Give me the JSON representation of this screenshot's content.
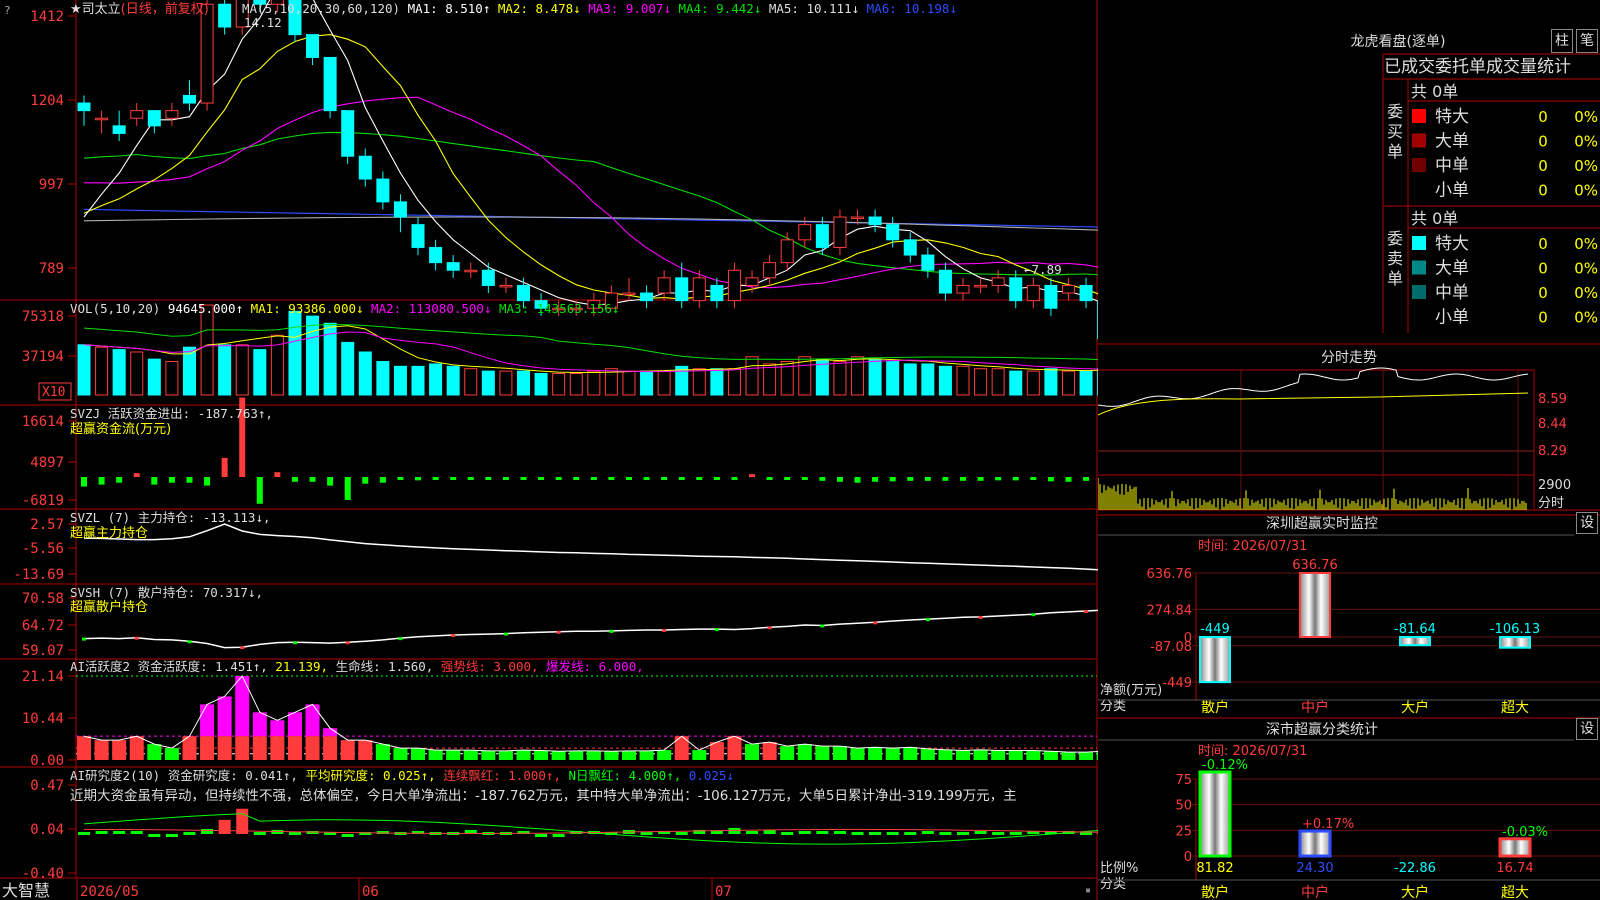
{
  "colors": {
    "up": "#ff3c3c",
    "down": "#00ffff",
    "ma1": "#ffffff",
    "ma2": "#ffff00",
    "ma3": "#ff00ff",
    "ma4": "#00e000",
    "ma5": "#b0b0b0",
    "ma6": "#2d4dff",
    "grid": "#b00000",
    "green": "#00ff00",
    "magenta": "#ff00ff",
    "yellow": "#ffff00"
  },
  "stock": {
    "title": "★司太立",
    "mode": "(日线，前复权)",
    "high_label": "14.12",
    "low_label": "←7.89"
  },
  "ma_legend": [
    {
      "label": "MA(5,10,20,30,60,120)",
      "color": "#dddddd"
    },
    {
      "label": "MA1: 8.510↑",
      "color": "#ffffff"
    },
    {
      "label": "MA2: 8.478↓",
      "color": "#ffff00"
    },
    {
      "label": "MA3: 9.007↓",
      "color": "#ff00ff"
    },
    {
      "label": "MA4: 9.442↓",
      "color": "#00e000"
    },
    {
      "label": "MA5: 10.111↓",
      "color": "#dddddd"
    },
    {
      "label": "MA6: 10.198↓",
      "color": "#2d4dff"
    }
  ],
  "price_ticks": [
    "1412",
    "1204",
    "997",
    "789"
  ],
  "vol_legend": [
    {
      "label": "VOL(5,10,20)",
      "color": "#dddddd"
    },
    {
      "label": "94645.000↑",
      "color": "#ffffff"
    },
    {
      "label": "MA1: 93386.000↓",
      "color": "#ffff00"
    },
    {
      "label": "MA2: 113080.500↓",
      "color": "#ff00ff"
    },
    {
      "label": "MA3: 143563.156↓",
      "color": "#00e000"
    }
  ],
  "vol_ticks": [
    "75318",
    "37194"
  ],
  "vol_unit": "X10",
  "svzj": {
    "legend": "SVZJ  活跃资金进出: -187.763↑,",
    "sub": "超赢资金流(万元)",
    "ticks": [
      "16614",
      "4897",
      "-6819"
    ]
  },
  "svzl": {
    "legend": "SVZL (7) 主力持仓: -13.113↓,",
    "sub": "超赢主力持仓",
    "ticks": [
      "2.57",
      "-5.56",
      "-13.69"
    ]
  },
  "svsh": {
    "legend": "SVSH (7) 散户持仓: 70.317↓,",
    "sub": "超赢散户持仓",
    "ticks": [
      "70.58",
      "64.72",
      "59.07"
    ]
  },
  "ai1": {
    "legend": [
      {
        "label": "AI活跃度2 资金活跃度: 1.451↑,",
        "color": "#dddddd"
      },
      {
        "label": "21.139,",
        "color": "#ffff00"
      },
      {
        "label": "生命线: 1.560,",
        "color": "#dddddd"
      },
      {
        "label": "强势线: 3.000,",
        "color": "#ff3c3c"
      },
      {
        "label": "爆发线: 6.000,",
        "color": "#ff00ff"
      }
    ],
    "ticks": [
      "21.14",
      "10.44",
      "0.00"
    ]
  },
  "ai2": {
    "legend": [
      {
        "label": "AI研究度2(10) 资金研究度: 0.041↑,",
        "color": "#dddddd"
      },
      {
        "label": "平均研究度: 0.025↑,",
        "color": "#ffff00"
      },
      {
        "label": "连续飘红: 1.000↑,",
        "color": "#ff3c3c"
      },
      {
        "label": "N日飘红: 4.000↑,",
        "color": "#00ff00"
      },
      {
        "label": "0.025↓",
        "color": "#2d4dff"
      }
    ],
    "comment": "近期大资金虽有异动，但持续性不强，总体偏空，今日大单净流出：-187.762万元，其中特大单净流出：-106.127万元，大单5日累计净出-319.199万元，主",
    "ticks": [
      "0.47",
      "0.04",
      "-0.40"
    ]
  },
  "x_axis": {
    "brand": "大智慧",
    "labels": [
      "2026/05",
      "06",
      "07"
    ]
  },
  "dragon": {
    "title": "龙虎看盘(逐单)",
    "btn_zhu": "柱",
    "btn_bi": "笔",
    "header": "已成交委托单成交量统计",
    "buy_label": "委买单",
    "sell_label": "委卖单",
    "buy_total": "共 0单",
    "sell_total": "共 0单",
    "rows": [
      {
        "label": "特大",
        "val": "0",
        "pct": "0%"
      },
      {
        "label": "大单",
        "val": "0",
        "pct": "0%"
      },
      {
        "label": "中单",
        "val": "0",
        "pct": "0%"
      },
      {
        "label": "小单",
        "val": "0",
        "pct": "0%"
      }
    ],
    "buy_colors": [
      "#ff0000",
      "#a00000",
      "#700000",
      "#000000"
    ],
    "sell_colors": [
      "#00ffff",
      "#008888",
      "#006b6b",
      "#000000"
    ]
  },
  "intraday": {
    "title": "分时走势",
    "ticks": [
      "8.59",
      "8.44",
      "8.29"
    ],
    "vol_tick": "2900",
    "vol_unit": "分时"
  },
  "monitor": {
    "title": "深圳超赢实时监控",
    "btn": "设",
    "time": "时间: 2026/07/31",
    "ticks": [
      "636.76",
      "274.84",
      "0",
      "-87.08",
      "-449"
    ],
    "unit": "净额(万元)",
    "cat_label": "分类",
    "bars": [
      {
        "name": "散户",
        "value": -449,
        "label": "-449"
      },
      {
        "name": "中户",
        "value": 636.76,
        "label": "636.76"
      },
      {
        "name": "大户",
        "value": -81.64,
        "label": "-81.64"
      },
      {
        "name": "超大",
        "value": -106.13,
        "label": "-106.13"
      }
    ]
  },
  "stats": {
    "title": "深市超赢分类统计",
    "btn": "设",
    "time": "时间: 2026/07/31",
    "ticks": [
      "75",
      "50",
      "25",
      "0"
    ],
    "unit": "比例%",
    "cat_label": "分类",
    "bars": [
      {
        "name": "散户",
        "value": 81.82,
        "label": "81.82",
        "change": "-0.12%"
      },
      {
        "name": "中户",
        "value": 24.3,
        "label": "24.30",
        "change": "+0.17%"
      },
      {
        "name": "大户",
        "value": -22.86,
        "label": "-22.86",
        "change": ""
      },
      {
        "name": "超大",
        "value": 16.74,
        "label": "16.74",
        "change": "-0.03%"
      }
    ]
  },
  "chart_data": [
    {
      "type": "candlestick",
      "title": "★司太立",
      "series": [
        {
          "name": "price",
          "open": [
            12.0,
            11.8,
            11.7,
            11.8,
            11.9,
            11.8,
            12.1,
            12.0,
            13.3,
            13.0,
            14.0,
            13.3,
            14.1,
            12.9,
            12.6,
            11.9,
            11.3,
            11.0,
            10.7,
            10.4,
            10.1,
            9.9,
            9.8,
            9.8,
            9.6,
            9.6,
            9.4,
            9.3,
            9.3,
            9.3,
            9.3,
            9.5,
            9.5,
            9.5,
            9.7,
            9.4,
            9.6,
            9.4,
            9.6,
            9.7,
            9.9,
            10.2,
            10.4,
            10.1,
            10.5,
            10.5,
            10.4,
            10.2,
            10.0,
            9.8,
            9.5,
            9.6,
            9.6,
            9.7,
            9.4,
            9.6,
            9.5,
            9.6,
            9.4,
            8.9,
            9.1,
            8.7,
            8.8,
            8.6,
            8.3,
            8.4,
            8.6,
            8.6,
            8.4,
            8.6
          ],
          "close": [
            11.9,
            11.8,
            11.6,
            11.9,
            11.7,
            11.9,
            12.0,
            13.3,
            13.0,
            14.0,
            13.3,
            14.1,
            12.9,
            12.6,
            11.9,
            11.3,
            11.0,
            10.7,
            10.5,
            10.1,
            9.9,
            9.8,
            9.8,
            9.6,
            9.6,
            9.4,
            9.3,
            9.3,
            9.3,
            9.4,
            9.5,
            9.5,
            9.4,
            9.7,
            9.4,
            9.7,
            9.4,
            9.8,
            9.7,
            9.9,
            10.2,
            10.4,
            10.1,
            10.5,
            10.5,
            10.4,
            10.2,
            10.0,
            9.8,
            9.5,
            9.6,
            9.6,
            9.7,
            9.4,
            9.6,
            9.3,
            9.6,
            9.4,
            8.9,
            8.6,
            8.8,
            8.7,
            8.6,
            8.3,
            8.5,
            8.6,
            8.6,
            8.5,
            8.6,
            8.6
          ],
          "high": [
            12.1,
            11.9,
            11.9,
            12.0,
            11.9,
            12.0,
            12.3,
            13.5,
            13.6,
            14.12,
            14.1,
            14.12,
            14.0,
            12.9,
            12.6,
            11.9,
            11.4,
            11.1,
            10.8,
            10.5,
            10.2,
            10.0,
            9.9,
            9.9,
            9.7,
            9.7,
            9.5,
            9.4,
            9.4,
            9.5,
            9.6,
            9.7,
            9.6,
            9.8,
            9.9,
            9.8,
            9.7,
            9.9,
            9.8,
            10.0,
            10.3,
            10.5,
            10.5,
            10.6,
            10.6,
            10.6,
            10.5,
            10.3,
            10.1,
            9.9,
            9.7,
            9.7,
            9.8,
            9.8,
            9.7,
            9.7,
            9.7,
            9.7,
            9.5,
            9.0,
            9.2,
            8.9,
            8.9,
            8.7,
            8.6,
            8.7,
            8.7,
            8.7,
            8.7,
            8.7
          ],
          "low": [
            11.7,
            11.6,
            11.5,
            11.7,
            11.6,
            11.7,
            11.9,
            11.9,
            12.9,
            12.9,
            13.2,
            13.2,
            12.8,
            12.5,
            11.8,
            11.2,
            10.9,
            10.6,
            10.3,
            10.0,
            9.8,
            9.7,
            9.7,
            9.5,
            9.5,
            9.3,
            9.2,
            9.2,
            9.2,
            9.2,
            9.3,
            9.4,
            9.3,
            9.4,
            9.3,
            9.3,
            9.3,
            9.3,
            9.5,
            9.6,
            9.8,
            10.1,
            10.0,
            10.0,
            10.4,
            10.3,
            10.1,
            9.9,
            9.7,
            9.4,
            9.4,
            9.5,
            9.5,
            9.3,
            9.3,
            9.2,
            9.4,
            9.3,
            8.8,
            8.5,
            8.6,
            8.6,
            8.5,
            7.89,
            8.2,
            8.3,
            8.5,
            8.4,
            8.4,
            8.5
          ]
        }
      ]
    },
    {
      "type": "bar",
      "title": "VOL(5,10,20)",
      "series": [
        {
          "name": "VOL",
          "values": [
            42000,
            40000,
            38000,
            36000,
            30000,
            28000,
            40000,
            75318,
            42000,
            42000,
            38000,
            50000,
            70000,
            66000,
            60000,
            44000,
            36000,
            28000,
            24000,
            24000,
            26000,
            24000,
            22000,
            20000,
            20000,
            20000,
            18000,
            18000,
            18000,
            20000,
            22000,
            20000,
            20000,
            20000,
            24000,
            22000,
            22000,
            22000,
            32000,
            26000,
            28000,
            32000,
            30000,
            28000,
            32000,
            30000,
            28000,
            26000,
            26000,
            24000,
            24000,
            22000,
            22000,
            20000,
            20000,
            22000,
            20000,
            20000,
            22000,
            20000,
            20000,
            18000,
            16000,
            16000,
            14000,
            12000,
            12000,
            10000,
            10000,
            9464
          ]
        }
      ]
    },
    {
      "type": "bar",
      "title": "SVZJ 活跃资金进出",
      "ylim": [
        -6819,
        16614
      ],
      "series": [
        {
          "name": "活跃资金进出",
          "values": [
            -2000,
            -1600,
            -1200,
            800,
            -1600,
            -1200,
            -1200,
            -1800,
            4000,
            16614,
            -5600,
            1000,
            -1000,
            -1000,
            -1800,
            -4800,
            -1400,
            -1200,
            -600,
            -700,
            -500,
            -400,
            -300,
            -300,
            -400,
            -300,
            -300,
            -300,
            -300,
            -300,
            -300,
            -300,
            -300,
            -500,
            -600,
            -500,
            -400,
            -500,
            600,
            -400,
            -500,
            -600,
            -800,
            -1000,
            -1200,
            -1000,
            -900,
            -800,
            -800,
            -800,
            -800,
            -800,
            -700,
            -700,
            -600,
            -900,
            -1000,
            -800,
            -600,
            -900,
            -1400,
            -500,
            -400,
            -400,
            -400,
            -300,
            -300,
            -300,
            -300,
            -188
          ]
        }
      ]
    },
    {
      "type": "line",
      "title": "SVZL (7) 主力持仓",
      "ylim": [
        -13.69,
        2.57
      ],
      "series": [
        {
          "name": "主力持仓",
          "values": [
            -2,
            -2.1,
            -2.3,
            -2.5,
            -2.5,
            -2.2,
            -1.6,
            0.4,
            2.57,
            0.3,
            -0.8,
            -1.2,
            -1.5,
            -1.9,
            -2.6,
            -3.2,
            -3.8,
            -4.2,
            -4.6,
            -4.9,
            -5.2,
            -5.5,
            -5.7,
            -5.9,
            -6.1,
            -6.3,
            -6.5,
            -6.7,
            -6.8,
            -7.0,
            -7.1,
            -7.3,
            -7.4,
            -7.6,
            -7.7,
            -7.9,
            -8.0,
            -8.1,
            -8.3,
            -8.4,
            -8.6,
            -8.8,
            -9.0,
            -9.2,
            -9.4,
            -9.6,
            -9.8,
            -10.0,
            -10.2,
            -10.4,
            -10.6,
            -10.8,
            -11.0,
            -11.2,
            -11.4,
            -11.6,
            -11.8,
            -12.1,
            -12.4,
            -12.7,
            -12.9,
            -13.0,
            -13.0,
            -13.0,
            -13.1,
            -13.1,
            -13.1,
            -13.1,
            -13.11,
            -13.113
          ]
        }
      ]
    },
    {
      "type": "line",
      "title": "SVSH (7) 散户持仓",
      "ylim": [
        59.07,
        70.58
      ],
      "series": [
        {
          "name": "散户持仓",
          "values": [
            61.6,
            61.7,
            61.6,
            61.8,
            61.4,
            61.3,
            61.0,
            60.5,
            59.6,
            59.7,
            60.3,
            60.7,
            60.8,
            60.7,
            60.6,
            60.8,
            61.0,
            61.3,
            61.7,
            62.0,
            62.2,
            62.4,
            62.5,
            62.6,
            62.7,
            62.9,
            63.0,
            63.1,
            63.2,
            63.2,
            63.3,
            63.4,
            63.5,
            63.5,
            63.6,
            63.7,
            63.7,
            63.6,
            63.8,
            64.1,
            64.3,
            64.6,
            64.5,
            64.8,
            65.0,
            65.2,
            65.5,
            65.7,
            65.9,
            66.1,
            66.3,
            66.4,
            66.6,
            66.8,
            67.0,
            67.3,
            67.5,
            67.7,
            67.9,
            68.1,
            68.5,
            69.1,
            69.6,
            70.0,
            70.2,
            70.3,
            70.3,
            70.3,
            70.32,
            70.317
          ]
        }
      ]
    },
    {
      "type": "bar",
      "title": "AI活跃度2 资金活跃度",
      "ylim": [
        0,
        21.14
      ],
      "series": [
        {
          "name": "资金活跃度",
          "values": [
            6,
            5,
            5,
            6,
            4,
            3,
            6,
            14,
            16,
            21.14,
            12,
            10,
            12,
            14,
            8,
            5,
            5,
            4,
            3,
            3,
            2.5,
            2.5,
            2.5,
            2.3,
            2.3,
            2.5,
            2.4,
            2.2,
            2.3,
            2.3,
            2.2,
            2.3,
            2.3,
            2.5,
            6,
            2.5,
            4.5,
            6,
            4,
            4.5,
            3.5,
            4,
            3.5,
            3.5,
            3,
            3.2,
            3,
            3.2,
            2.8,
            2.6,
            2.4,
            2.6,
            2.4,
            2.4,
            2.4,
            2.2,
            2,
            2,
            2.2,
            2,
            2,
            2,
            1.8,
            1.8,
            1.8,
            1.8,
            1.6,
            1.6,
            1.5,
            1.451
          ]
        },
        {
          "name": "生命线",
          "values": [
            1.56
          ]
        },
        {
          "name": "强势线",
          "values": [
            3
          ]
        },
        {
          "name": "爆发线",
          "values": [
            6
          ]
        }
      ]
    },
    {
      "type": "bar",
      "title": "AI研究度2(10) 资金研究度",
      "ylim": [
        -0.4,
        0.47
      ],
      "series": [
        {
          "name": "资金研究度",
          "values": [
            0.02,
            0.03,
            0.03,
            0.03,
            -0.01,
            -0.02,
            0.02,
            0.05,
            0.14,
            0.25,
            0.02,
            0.04,
            0.02,
            0.03,
            0.02,
            -0.01,
            0.02,
            0.03,
            0.02,
            0.03,
            0.02,
            0.02,
            0.04,
            0.02,
            0.02,
            0.03,
            -0.02,
            -0.03,
            0.03,
            0.03,
            0.02,
            0.04,
            0.02,
            0.03,
            0.02,
            0.04,
            0.03,
            0.06,
            0.03,
            0.04,
            0.02,
            0.03,
            0.03,
            0.03,
            0.02,
            0.02,
            0.02,
            0.02,
            0.03,
            0.02,
            0.02,
            0.03,
            0.02,
            0.02,
            0.03,
            0.03,
            0.03,
            0.02,
            0.03,
            0.02,
            0.03,
            0.02,
            0.02,
            0.03,
            0.02,
            0.03,
            0.02,
            -0.05,
            0.02,
            0.041
          ]
        }
      ]
    }
  ]
}
